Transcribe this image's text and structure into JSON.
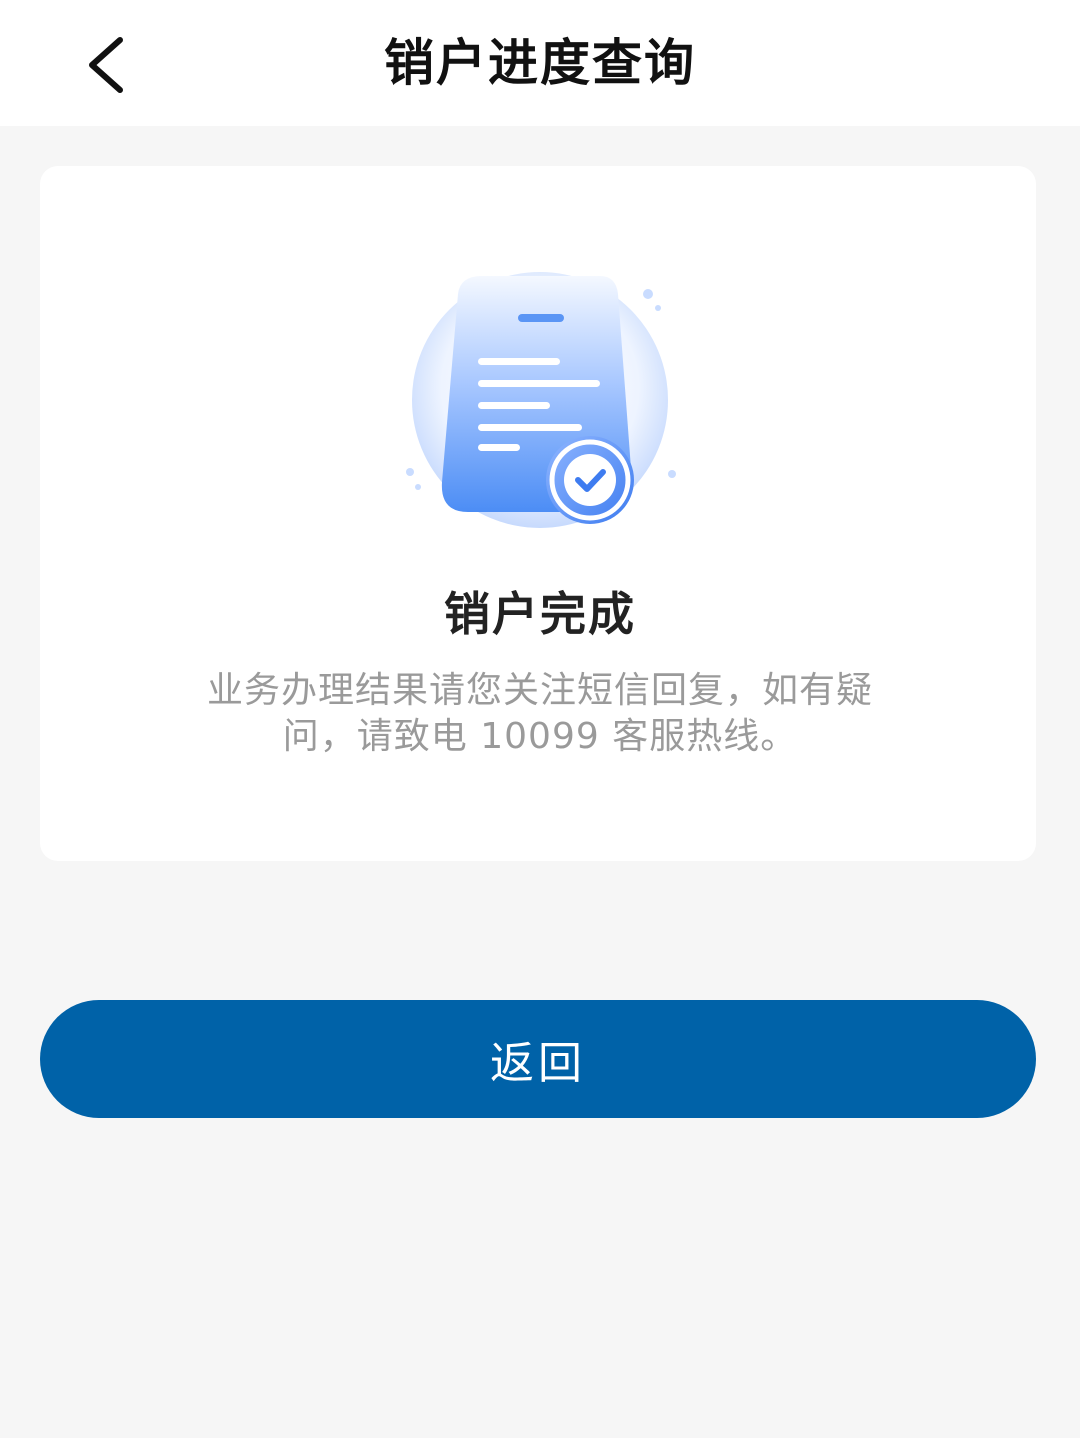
{
  "header": {
    "title": "销户进度查询",
    "back_icon": "chevron-left-icon"
  },
  "result": {
    "illustration_icon": "document-check-icon",
    "title": "销户完成",
    "message": "业务办理结果请您关注短信回复，如有疑问，请致电 10099 客服热线。"
  },
  "actions": {
    "return_label": "返回"
  },
  "colors": {
    "page_background": "#f6f6f6",
    "primary_button": "#0062a8",
    "illustration_blue": "#4c8df5"
  }
}
